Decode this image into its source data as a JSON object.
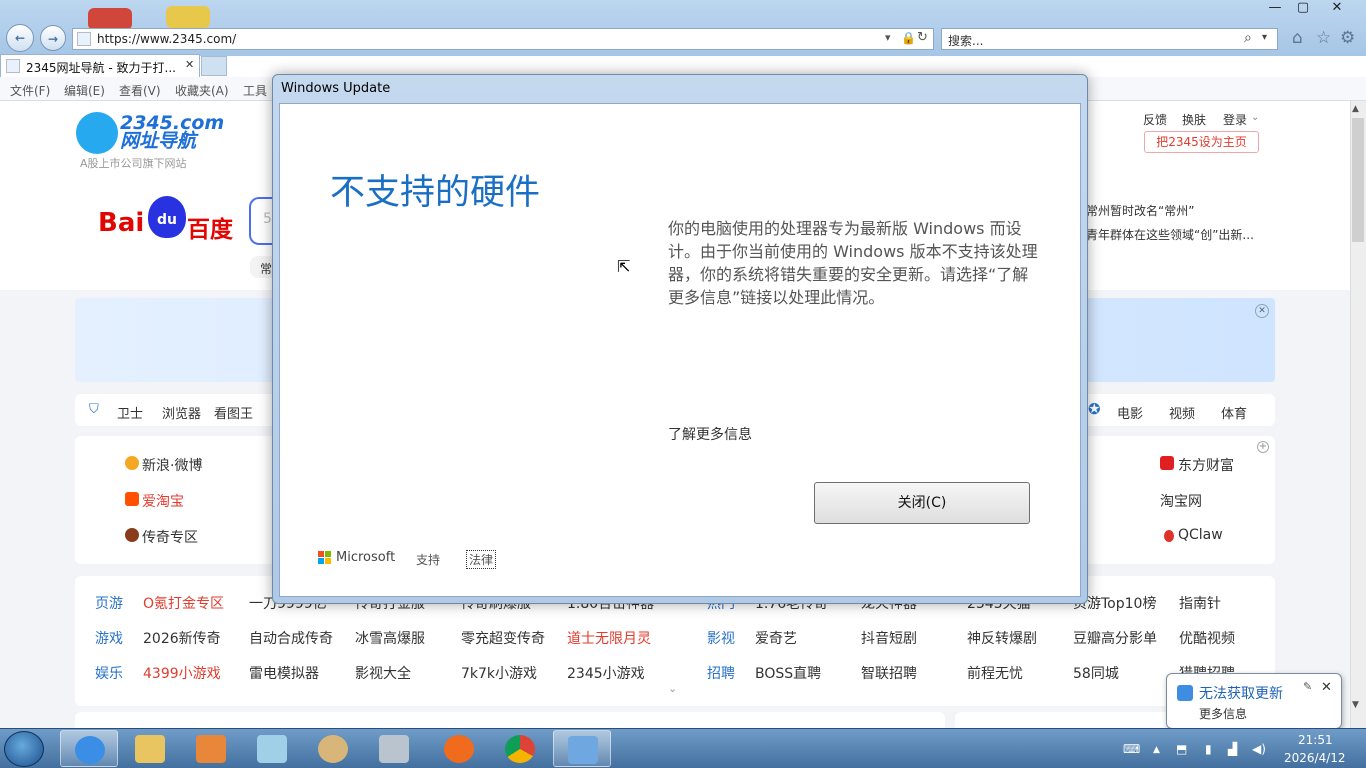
{
  "browser": {
    "url": "https://www.2345.com/",
    "search_placeholder": "搜索...",
    "tab_title": "2345网址导航 - 致力于打...",
    "tab_close": "✕",
    "window_controls": [
      "—",
      "▢",
      "✕"
    ],
    "menu": [
      "文件(F)",
      "编辑(E)",
      "查看(V)",
      "收藏夹(A)",
      "工具"
    ]
  },
  "page": {
    "logo_text": "2345.com",
    "logo_text2": "网址导航",
    "logo_sub": "A股上市公司旗下网站",
    "baidu_en": "Bai",
    "baidu_paw": "du",
    "baidu_zh": "百度",
    "header_links": [
      "反馈",
      "换肤",
      "登录"
    ],
    "set_home": "把2345设为主页",
    "partial_search_char": "5",
    "partial_changyong": "常",
    "news": [
      "常州暂时改名“常州”",
      "青年群体在这些领域“创”出新..."
    ],
    "toolbar_left": [
      "卫士",
      "浏览器",
      "看图王"
    ],
    "toolbar_right": [
      "电影",
      "视频",
      "体育"
    ],
    "sites_left": [
      "新浪·微博",
      "爱淘宝",
      "传奇专区"
    ],
    "sites_right": [
      "东方财富",
      "淘宝网",
      "QClaw"
    ],
    "rows": [
      {
        "cat": "页游",
        "items": [
          "O氪打金专区",
          "一刀9999亿",
          "传奇打金服",
          "传奇刷爆服",
          "1.80合击神器"
        ],
        "cat2": "热门",
        "items2": [
          "1.76老传奇",
          "龙火神器",
          "2345天猫",
          "页游Top10榜",
          "指南针"
        ]
      },
      {
        "cat": "游戏",
        "items": [
          "2026新传奇",
          "自动合成传奇",
          "冰雪高爆服",
          "零充超变传奇",
          "道士无限月灵"
        ],
        "cat2": "影视",
        "items2": [
          "爱奇艺",
          "抖音短剧",
          "神反转爆剧",
          "豆瓣高分影单",
          "优酷视频"
        ]
      },
      {
        "cat": "娱乐",
        "items": [
          "4399小游戏",
          "雷电模拟器",
          "影视大全",
          "7k7k小游戏",
          "2345小游戏"
        ],
        "cat2": "招聘",
        "items2": [
          "BOSS直聘",
          "智联招聘",
          "前程无忧",
          "58同城",
          "猎聘招聘"
        ]
      }
    ]
  },
  "dialog": {
    "title": "Windows Update",
    "heading": "不支持的硬件",
    "description": "你的电脑使用的处理器专为最新版 Windows 而设计。由于你当前使用的 Windows 版本不支持该处理器，你的系统将错失重要的安全更新。请选择“了解更多信息”链接以处理此情况。",
    "learn_more": "了解更多信息",
    "close_button": "关闭(C)",
    "microsoft": "Microsoft",
    "support": "支持",
    "legal": "法律"
  },
  "notification": {
    "title": "无法获取更新",
    "subtitle": "更多信息",
    "close": "✕"
  },
  "taskbar": {
    "time": "21:51",
    "date": "2026/4/12"
  }
}
